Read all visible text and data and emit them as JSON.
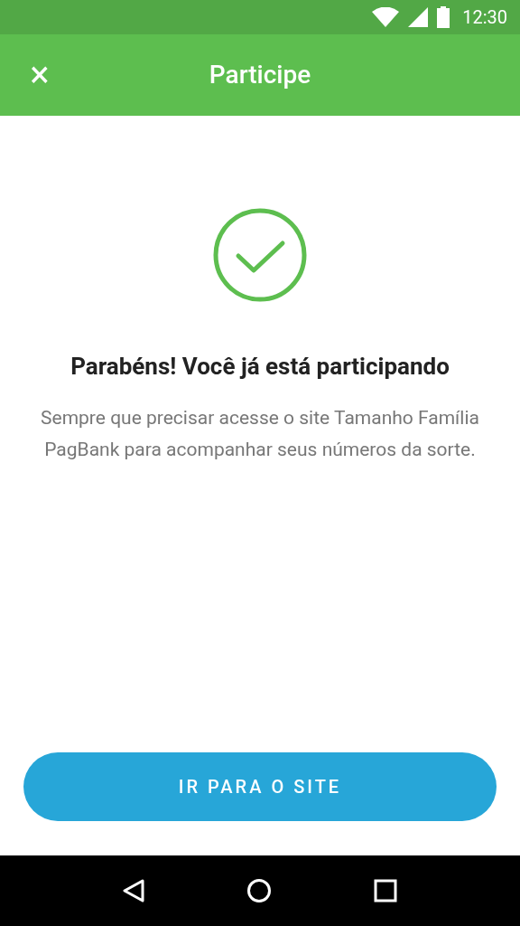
{
  "status_bar": {
    "time": "12:30"
  },
  "toolbar": {
    "close": "×",
    "title": "Participe"
  },
  "message": {
    "heading": "Parabéns! Você já está participando",
    "body": "Sempre que precisar acesse o site Tamanho Família PagBank para acompanhar seus números da sorte."
  },
  "button": {
    "label": "IR PARA O SITE"
  }
}
